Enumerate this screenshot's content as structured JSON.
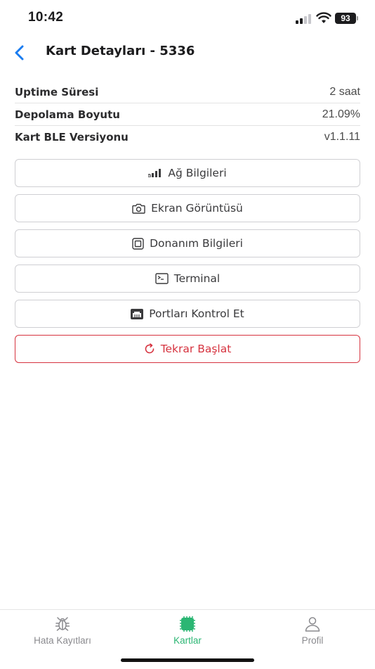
{
  "status_bar": {
    "time": "10:42",
    "battery": "93"
  },
  "header": {
    "title": "Kart Detayları - 5336"
  },
  "info_rows": [
    {
      "label": "Uptime Süresi",
      "value": "2 saat"
    },
    {
      "label": "Depolama Boyutu",
      "value": "21.09%"
    },
    {
      "label": "Kart BLE Versiyonu",
      "value": "v1.1.11"
    }
  ],
  "actions": [
    {
      "label": "Ağ Bilgileri",
      "icon": "signal-bars-icon"
    },
    {
      "label": "Ekran Görüntüsü",
      "icon": "camera-icon"
    },
    {
      "label": "Donanım Bilgileri",
      "icon": "chip-icon"
    },
    {
      "label": "Terminal",
      "icon": "terminal-icon"
    },
    {
      "label": "Portları Kontrol Et",
      "icon": "ethernet-port-icon"
    },
    {
      "label": "Tekrar Başlat",
      "icon": "restart-icon"
    }
  ],
  "tabs": [
    {
      "label": "Hata Kayıtları",
      "icon": "bug-icon",
      "active": false
    },
    {
      "label": "Kartlar",
      "icon": "board-chip-icon",
      "active": true
    },
    {
      "label": "Profil",
      "icon": "person-icon",
      "active": false
    }
  ],
  "colors": {
    "accent": "#2bb673",
    "danger": "#d6333f",
    "link": "#1a7cf0"
  }
}
